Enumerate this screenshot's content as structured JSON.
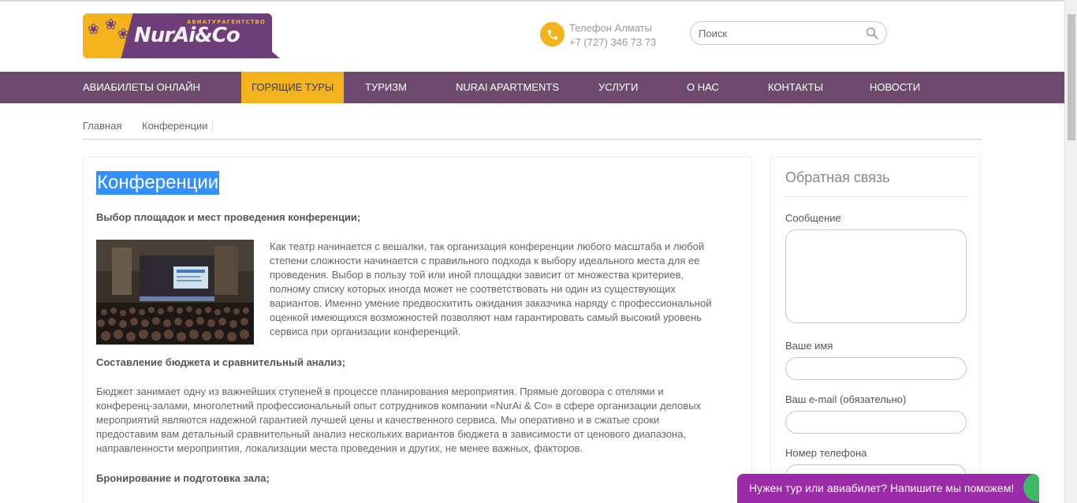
{
  "header": {
    "logo_text": "NurAi&Co",
    "logo_subtitle": "АВИАТУРАГЕНТСТВО",
    "phone_label": "Телефон Алматы",
    "phone_number": "+7 (727) 346 73 73",
    "search_placeholder": "Поиск"
  },
  "nav": {
    "items": [
      {
        "label": "Авиабилеты онлайн"
      },
      {
        "label": "Горящие туры",
        "active": true
      },
      {
        "label": "Туризм"
      },
      {
        "label": "NurAi Apartments"
      },
      {
        "label": "Услуги"
      },
      {
        "label": "О нас"
      },
      {
        "label": "Контакты"
      },
      {
        "label": "Новости"
      }
    ]
  },
  "breadcrumb": {
    "home": "Главная",
    "current": "Конференции"
  },
  "main": {
    "title": "Конференции",
    "section1_heading": "Выбор площадок и мест проведения конференции;",
    "section1_lines": [
      "Как театр начинается с вешалки, так организация конференции любого масштаба и любой",
      "степени сложности начинается с правильного подхода к выбору идеального места для ее",
      "проведения. Выбор в пользу той или иной площадки зависит от множества критериев,",
      "полному списку которых иногда может не соответствовать ни один из существующих",
      "вариантов. Именно умение предвосхитить ожидания заказчика наряду с профессиональной",
      "оценкой имеющихся возможностей позволяют нам гарантировать самый высокий уровень",
      "сервиса при организации конференций."
    ],
    "section2_heading": "Составление бюджета и сравнительный анализ;",
    "section2_lines": [
      "Бюджет занимает одну из важнейших ступеней в процессе планирования мероприятия. Прямые договора с отелями и",
      "конференц-залами, многолетний профессиональный опыт сотрудников компании «NurAi & Co» в сфере организации деловых",
      "мероприятий являются надежной гарантией лучшей цены и качественного сервиса. Мы оперативно и в сжатые сроки",
      "предоставим вам детальный сравнительный анализ нескольких вариантов бюджета в зависимости от ценового диапазона,",
      "направленности мероприятия, локализации места проведения и других, не менее важных, факторов."
    ],
    "section3_heading": "Бронирование и подготовка зала;"
  },
  "sidebar": {
    "title": "Обратная связь",
    "message_label": "Сообщение",
    "name_label": "Ваше имя",
    "email_label": "Ваш e-mail (обязательно)",
    "phone_label": "Номер телефона"
  },
  "chat": {
    "label": "Нужен тур или авиабилет? Напишите мы поможем!"
  },
  "colors": {
    "nav_bg": "#6e4b6e",
    "accent_yellow": "#f2b31c",
    "logo_purple": "#6e3e78",
    "chat_bg": "#9b2aa6",
    "selection_blue": "#3390ff"
  }
}
